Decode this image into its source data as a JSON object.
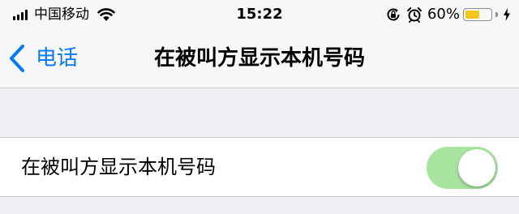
{
  "status_bar": {
    "carrier": "中国移动",
    "time": "15:22",
    "battery_percent": "60%",
    "battery_level": 0.6,
    "battery_color": "#f5c518",
    "icons": [
      "signal-icon",
      "wifi-icon",
      "orientation-lock-icon",
      "alarm-icon",
      "battery-icon",
      "charging-bolt-icon"
    ]
  },
  "nav": {
    "back_label": "电话",
    "title": "在被叫方显示本机号码"
  },
  "setting": {
    "label": "在被叫方显示本机号码",
    "enabled": true
  },
  "colors": {
    "accent": "#007aff",
    "toggle_on": "#a8e4a0",
    "background": "#efeff4"
  }
}
